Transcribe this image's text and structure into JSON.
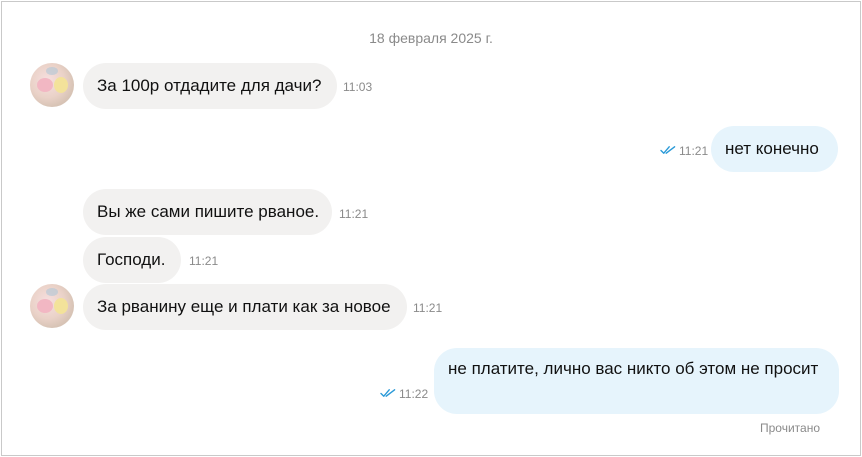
{
  "chat": {
    "date": "18 февраля 2025 г.",
    "messages": [
      {
        "dir": "in",
        "text": "За 100р отдадите для дачи?",
        "time": "11:03"
      },
      {
        "dir": "out",
        "text": "нет конечно",
        "time": "11:21"
      },
      {
        "dir": "in",
        "text": "Вы же сами пишите рваное.",
        "time": "11:21"
      },
      {
        "dir": "in",
        "text": "Господи.",
        "time": "11:21"
      },
      {
        "dir": "in",
        "text": "За рванину еще и плати как за новое",
        "time": "11:21"
      },
      {
        "dir": "out",
        "text": "не платите, лично вас никто об этом не просит",
        "time": "11:22"
      }
    ],
    "read_status": "Прочитано"
  },
  "colors": {
    "incoming_bubble": "#f2f1f0",
    "outgoing_bubble": "#e6f4fc",
    "read_ticks": "#2a9ad8"
  },
  "icons": {
    "read_receipt": "double-check-icon",
    "sender_avatar": "avatar"
  }
}
